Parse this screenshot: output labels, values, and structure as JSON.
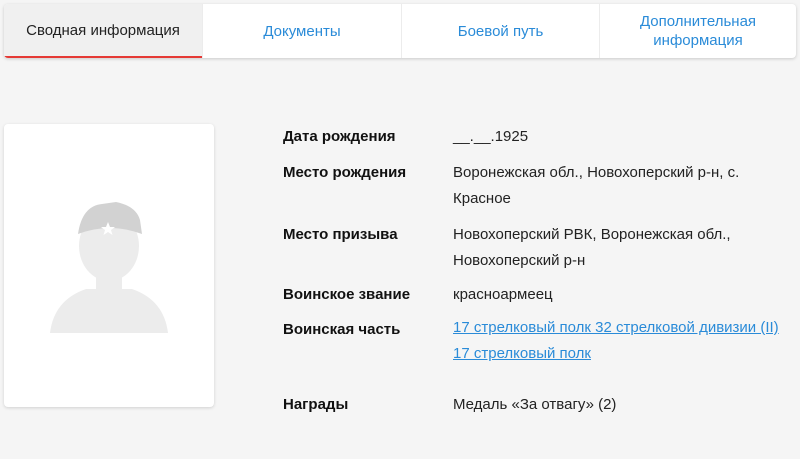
{
  "tabs": [
    {
      "label": "Сводная информация",
      "active": true
    },
    {
      "label": "Документы",
      "active": false
    },
    {
      "label": "Боевой путь",
      "active": false
    },
    {
      "label": "Дополнительная информация",
      "active": false
    }
  ],
  "photo": {
    "icon": "soldier-silhouette-icon"
  },
  "info": {
    "birth_date": {
      "label": "Дата рождения",
      "value": "__.__.1925"
    },
    "birth_place": {
      "label": "Место рождения",
      "value": "Воронежская обл., Новохоперский р-н, с. Красное"
    },
    "conscription_place": {
      "label": "Место призыва",
      "value": "Новохоперский РВК, Воронежская обл., Новохоперский р-н"
    },
    "rank": {
      "label": "Воинское звание",
      "value": "красноармеец"
    },
    "unit": {
      "label": "Воинская часть",
      "links": [
        "17 стрелковый полк 32 стрелковой дивизии (II)",
        "17 стрелковый полк"
      ]
    },
    "awards": {
      "label": "Награды",
      "value": "Медаль «За отвагу» (2)"
    }
  },
  "colors": {
    "link": "#2a8bd8",
    "active_tab_underline": "#e53935",
    "background": "#f5f5f5"
  }
}
